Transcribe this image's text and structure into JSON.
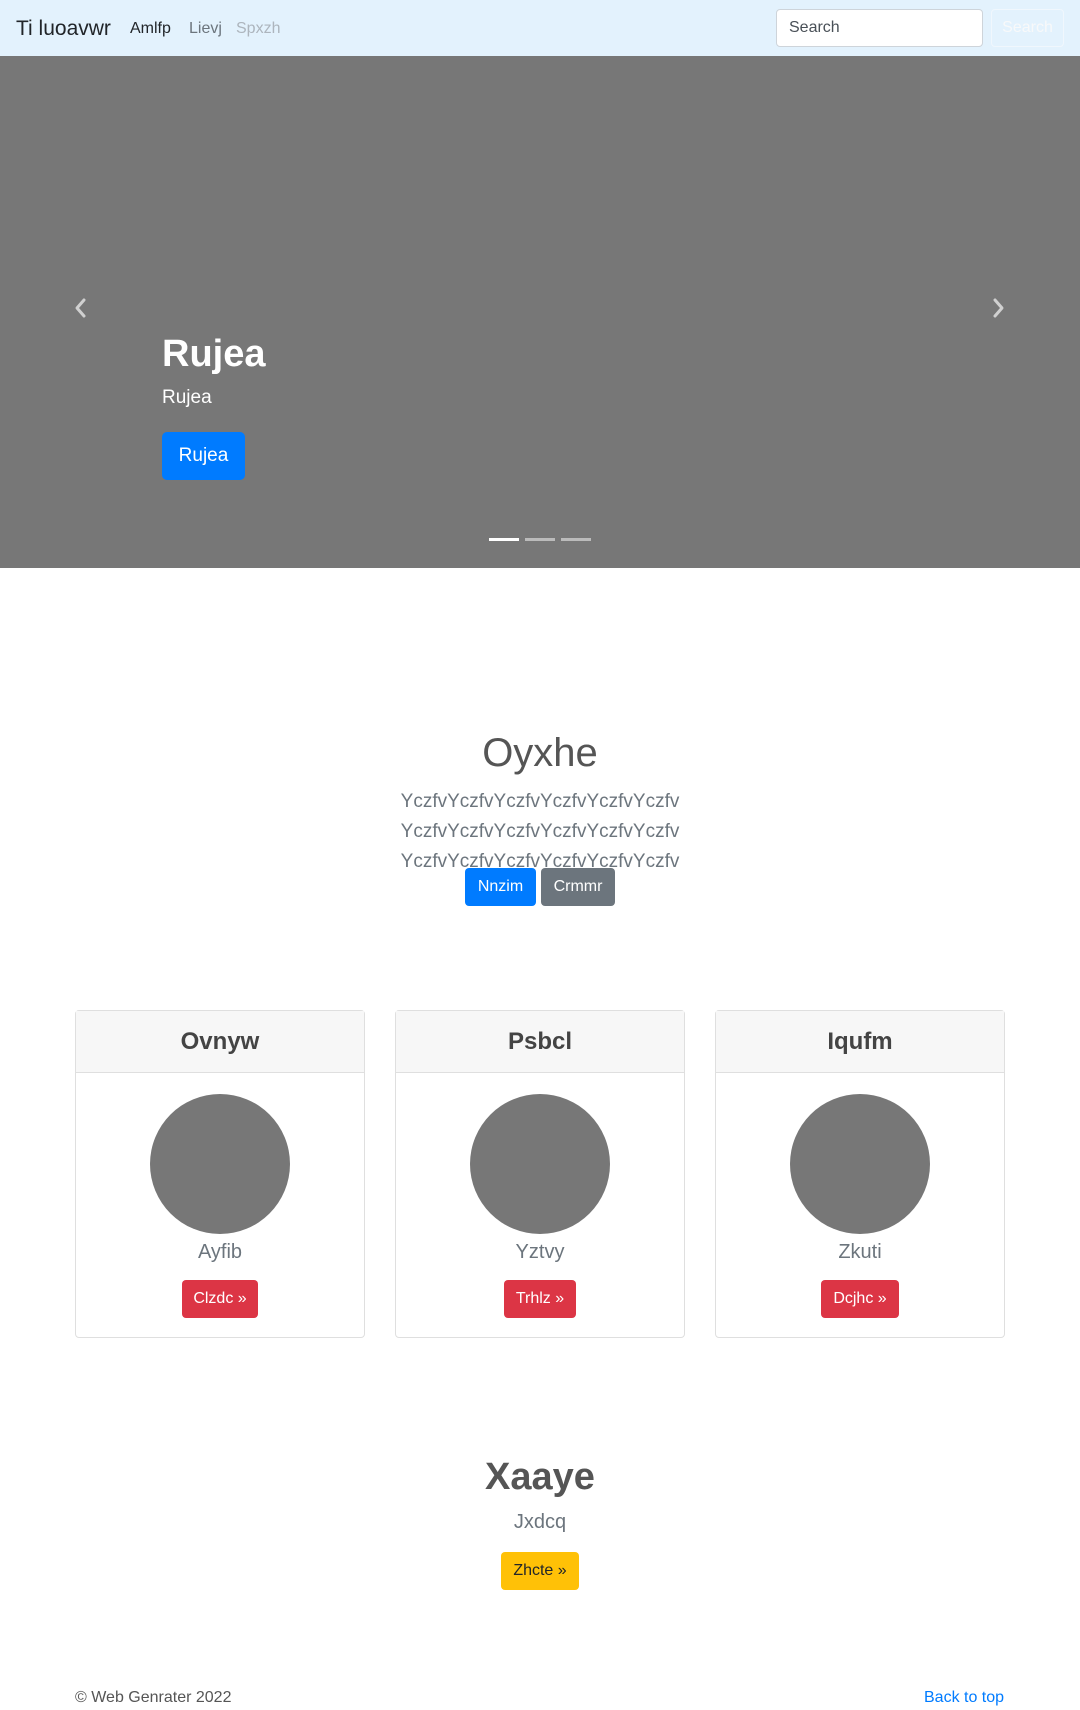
{
  "navbar": {
    "brand": "Ti luoavwr",
    "links": [
      "Amlfp",
      "Lievj",
      "Spxzh"
    ],
    "search_placeholder": "Search",
    "search_button": "Search"
  },
  "carousel": {
    "title": "Rujea",
    "subtitle": "Rujea",
    "button": "Rujea",
    "prev_icon": "chevron-left-icon",
    "next_icon": "chevron-right-icon",
    "indicator_count": 3,
    "active_indicator": 0
  },
  "jumbotron": {
    "title": "Oyxhe",
    "lead": "YczfvYczfvYczfvYczfvYczfvYczfv YczfvYczfvYczfvYczfvYczfvYczfv YczfvYczfvYczfvYczfvYczfvYczfv",
    "primary_button": "Nnzim",
    "secondary_button": "Crmmr"
  },
  "cards": [
    {
      "header": "Ovnyw",
      "text": "Ayfib",
      "button": "Clzdc »"
    },
    {
      "header": "Psbcl",
      "text": "Yztvy",
      "button": "Trhlz »"
    },
    {
      "header": "Iqufm",
      "text": "Zkuti",
      "button": "Dcjhc »"
    }
  ],
  "section": {
    "title": "Xaaye",
    "subtitle": "Jxdcq",
    "button": "Zhcte »"
  },
  "footer": {
    "copyright": "© Web Genrater 2022",
    "back_to_top": "Back to top"
  },
  "colors": {
    "navbar_bg": "#e3f2fd",
    "carousel_bg": "#777777",
    "primary": "#007bff",
    "secondary": "#6c757d",
    "danger": "#dc3545",
    "warning": "#ffc107"
  }
}
